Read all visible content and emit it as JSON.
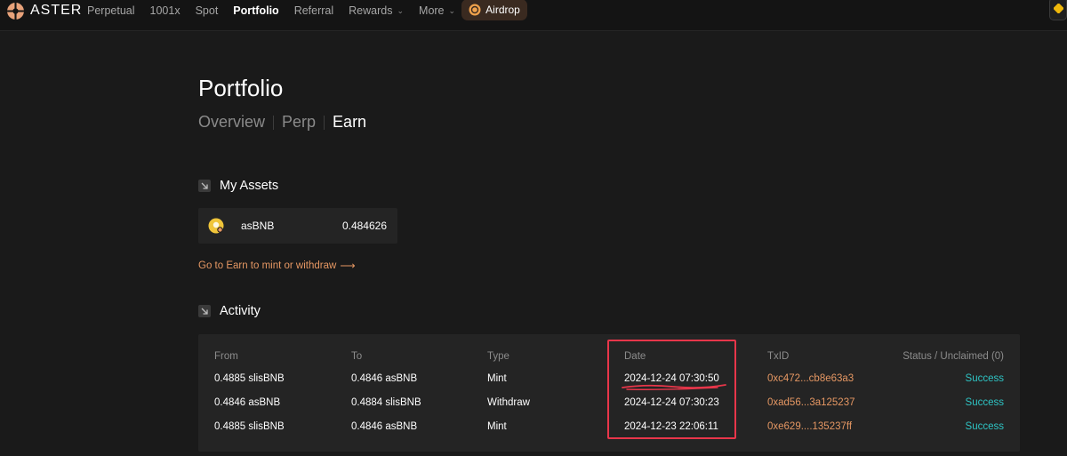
{
  "brand": {
    "name": "ASTER"
  },
  "nav": {
    "items": [
      {
        "label": "Perpetual",
        "active": false,
        "dropdown": false
      },
      {
        "label": "1001x",
        "active": false,
        "dropdown": false
      },
      {
        "label": "Spot",
        "active": false,
        "dropdown": false
      },
      {
        "label": "Portfolio",
        "active": true,
        "dropdown": false
      },
      {
        "label": "Referral",
        "active": false,
        "dropdown": false
      },
      {
        "label": "Rewards",
        "active": false,
        "dropdown": true
      },
      {
        "label": "More",
        "active": false,
        "dropdown": true
      }
    ],
    "airdrop_label": "Airdrop"
  },
  "page": {
    "title": "Portfolio",
    "tabs": [
      {
        "label": "Overview",
        "active": false
      },
      {
        "label": "Perp",
        "active": false
      },
      {
        "label": "Earn",
        "active": true
      }
    ]
  },
  "assets": {
    "title": "My Assets",
    "items": [
      {
        "symbol": "asBNB",
        "amount": "0.484626"
      }
    ],
    "earn_link": "Go to Earn to mint or withdraw"
  },
  "activity": {
    "title": "Activity",
    "columns": {
      "from": "From",
      "to": "To",
      "type": "Type",
      "date": "Date",
      "txid": "TxID",
      "status": "Status / Unclaimed (0)"
    },
    "rows": [
      {
        "from": "0.4885 slisBNB",
        "to": "0.4846 asBNB",
        "type": "Mint",
        "date": "2024-12-24 07:30:50",
        "txid": "0xc472...cb8e63a3",
        "status": "Success"
      },
      {
        "from": "0.4846 asBNB",
        "to": "0.4884 slisBNB",
        "type": "Withdraw",
        "date": "2024-12-24 07:30:23",
        "txid": "0xad56...3a125237",
        "status": "Success"
      },
      {
        "from": "0.4885 slisBNB",
        "to": "0.4846 asBNB",
        "type": "Mint",
        "date": "2024-12-23 22:06:11",
        "txid": "0xe629....135237ff",
        "status": "Success"
      }
    ]
  },
  "colors": {
    "background": "#1a1a1a",
    "card": "#242424",
    "accent_orange": "#e59763",
    "success": "#2ec4c4",
    "annotation_red": "#e8364a"
  },
  "icons": {
    "logo": "aster-logo-icon",
    "airdrop": "airdrop-coin-icon",
    "wallet": "wallet-icon",
    "section": "arrow-down-right-icon",
    "asset": "asbnb-token-icon",
    "link_arrow": "long-arrow-right-icon"
  }
}
